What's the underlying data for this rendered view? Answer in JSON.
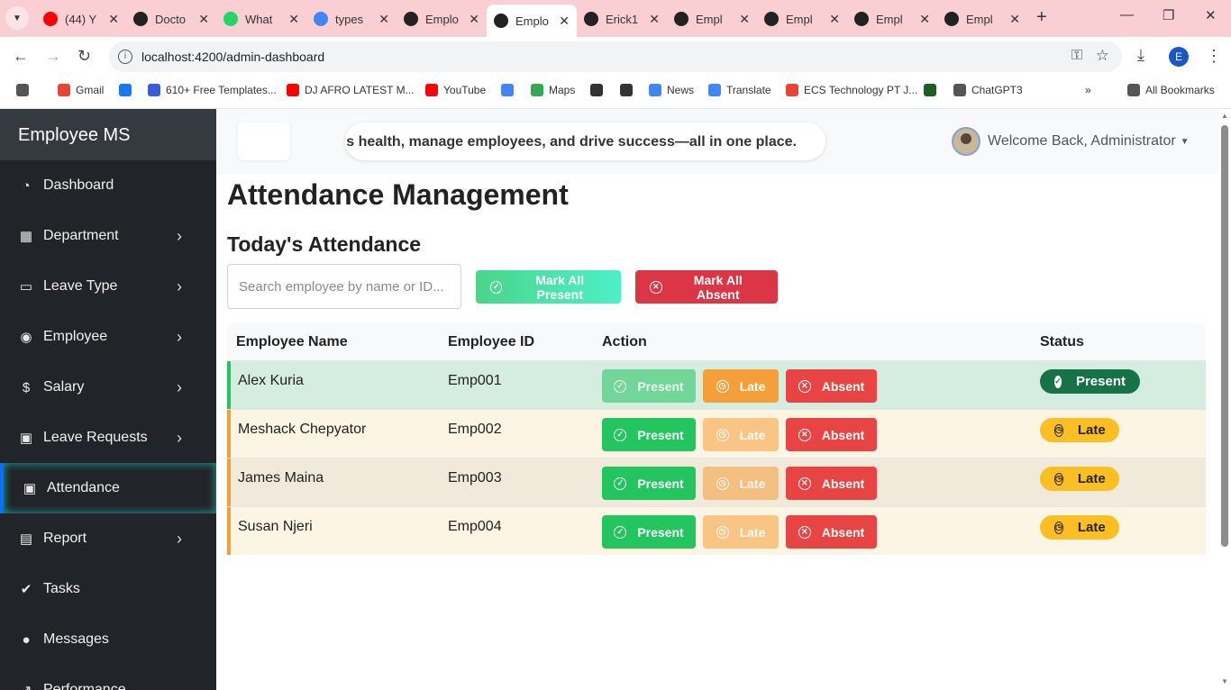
{
  "browser": {
    "tabs": [
      {
        "title": "(44) Y",
        "fav_color": "#ff0000",
        "icon": "youtube-icon"
      },
      {
        "title": "Docto",
        "fav_color": "#222222",
        "icon": "openai-icon"
      },
      {
        "title": "What",
        "fav_color": "#25d366",
        "icon": "whatsapp-icon"
      },
      {
        "title": "types",
        "fav_color": "#4285f4",
        "icon": "google-icon"
      },
      {
        "title": "Emplo",
        "fav_color": "#222222",
        "icon": "angular-icon"
      },
      {
        "title": "Emplo",
        "fav_color": "#222222",
        "icon": "angular-icon",
        "active": true
      },
      {
        "title": "Erick1",
        "fav_color": "#222222",
        "icon": "github-icon"
      },
      {
        "title": "Empl",
        "fav_color": "#222222",
        "icon": "github-icon"
      },
      {
        "title": "Empl",
        "fav_color": "#222222",
        "icon": "github-icon"
      },
      {
        "title": "Empl",
        "fav_color": "#222222",
        "icon": "github-icon"
      },
      {
        "title": "Empl",
        "fav_color": "#222222",
        "icon": "github-icon"
      }
    ],
    "url": "localhost:4200/admin-dashboard",
    "profile_initial": "E",
    "bookmarks": [
      {
        "label": "",
        "icon": "apps-grid-icon",
        "color": "#555555"
      },
      {
        "label": "Gmail",
        "icon": "gmail-icon",
        "color": "#ea4335"
      },
      {
        "label": "",
        "icon": "facebook-icon",
        "color": "#1877f2"
      },
      {
        "label": "610+ Free Templates...",
        "icon": "template-icon",
        "color": "#3b5bdb"
      },
      {
        "label": "DJ AFRO LATEST M...",
        "icon": "youtube-icon",
        "color": "#ff0000"
      },
      {
        "label": "YouTube",
        "icon": "youtube-icon",
        "color": "#ff0000"
      },
      {
        "label": "",
        "icon": "google-icon",
        "color": "#4285f4"
      },
      {
        "label": "Maps",
        "icon": "maps-icon",
        "color": "#34a853"
      },
      {
        "label": "",
        "icon": "globe-icon",
        "color": "#333333"
      },
      {
        "label": "",
        "icon": "globe-icon",
        "color": "#333333"
      },
      {
        "label": "News",
        "icon": "news-icon",
        "color": "#4285f4"
      },
      {
        "label": "Translate",
        "icon": "translate-icon",
        "color": "#4285f4"
      },
      {
        "label": "ECS Technology PT J...",
        "icon": "google-icon",
        "color": "#ea4335"
      },
      {
        "label": "",
        "icon": "campus-icon",
        "color": "#1b5e20"
      },
      {
        "label": "ChatGPT3",
        "icon": "folder-icon",
        "color": "#555555"
      },
      {
        "label": "»",
        "icon": "more-bookmarks-icon",
        "color": "#555555"
      },
      {
        "label": "All Bookmarks",
        "icon": "folder-icon",
        "color": "#555555"
      }
    ]
  },
  "sidebar": {
    "brand": "Employee MS",
    "items": [
      {
        "label": "Dashboard",
        "icon": "dashboard-icon",
        "glyph": "◔",
        "chevron": false
      },
      {
        "label": "Department",
        "icon": "building-icon",
        "glyph": "▦",
        "chevron": true
      },
      {
        "label": "Leave Type",
        "icon": "inbox-icon",
        "glyph": "▭",
        "chevron": true
      },
      {
        "label": "Employee",
        "icon": "user-circle-icon",
        "glyph": "◉",
        "chevron": true
      },
      {
        "label": "Salary",
        "icon": "dollar-icon",
        "glyph": "$",
        "chevron": true
      },
      {
        "label": "Leave Requests",
        "icon": "calendar-check-icon",
        "glyph": "▣",
        "chevron": true
      },
      {
        "label": "Attendance",
        "icon": "calendar-icon",
        "glyph": "▣",
        "chevron": false,
        "active": true
      },
      {
        "label": "Report",
        "icon": "report-icon",
        "glyph": "▤",
        "chevron": true
      },
      {
        "label": "Tasks",
        "icon": "check-circle-icon",
        "glyph": "✔",
        "chevron": false
      },
      {
        "label": "Messages",
        "icon": "chat-icon",
        "glyph": "●",
        "chevron": false
      },
      {
        "label": "Performance",
        "icon": "chart-icon",
        "glyph": "↗",
        "chevron": false
      }
    ]
  },
  "topbar": {
    "marquee": "tion's health, manage employees, and drive success—all in one place.",
    "welcome": "Welcome Back, Administrator"
  },
  "page": {
    "title": "Attendance Management",
    "section": "Today's Attendance",
    "search_placeholder": "Search employee by name or ID...",
    "mark_all_present": "Mark All Present",
    "mark_all_absent": "Mark All Absent"
  },
  "table": {
    "headers": [
      "Employee Name",
      "Employee ID",
      "Action",
      "Status"
    ],
    "action_labels": {
      "present": "Present",
      "late": "Late",
      "absent": "Absent"
    },
    "rows": [
      {
        "name": "Alex Kuria",
        "id": "Emp001",
        "status": "Present",
        "row_color": "#d5ece0",
        "edge_color": "#22c55e"
      },
      {
        "name": "Meshack Chepyator",
        "id": "Emp002",
        "status": "Late",
        "row_color": "#fdf5e3",
        "edge_color": "#f59f3a"
      },
      {
        "name": "James Maina",
        "id": "Emp003",
        "status": "Late",
        "row_color": "#f1eadb",
        "edge_color": "#f59f3a"
      },
      {
        "name": "Susan Njeri",
        "id": "Emp004",
        "status": "Late",
        "row_color": "#fdf5e3",
        "edge_color": "#f59f3a"
      }
    ]
  }
}
